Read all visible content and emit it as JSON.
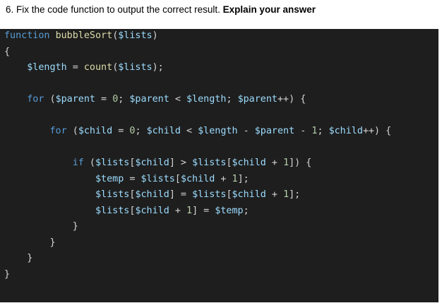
{
  "question": {
    "prefix": "6. Fix the code function to output the correct result. ",
    "bold": "Explain your answer"
  },
  "code": {
    "lines": [
      [
        {
          "t": "function",
          "c": "kw"
        },
        {
          "t": " ",
          "c": "op"
        },
        {
          "t": "bubbleSort",
          "c": "fn"
        },
        {
          "t": "(",
          "c": "op"
        },
        {
          "t": "$lists",
          "c": "var"
        },
        {
          "t": ")",
          "c": "op"
        }
      ],
      [
        {
          "t": "{",
          "c": "op"
        }
      ],
      [
        {
          "t": "    ",
          "c": "op"
        },
        {
          "t": "$length",
          "c": "var"
        },
        {
          "t": " = ",
          "c": "op"
        },
        {
          "t": "count",
          "c": "fn"
        },
        {
          "t": "(",
          "c": "op"
        },
        {
          "t": "$lists",
          "c": "var"
        },
        {
          "t": ");",
          "c": "op"
        }
      ],
      [],
      [
        {
          "t": "    ",
          "c": "op"
        },
        {
          "t": "for",
          "c": "kw"
        },
        {
          "t": " (",
          "c": "op"
        },
        {
          "t": "$parent",
          "c": "var"
        },
        {
          "t": " = ",
          "c": "op"
        },
        {
          "t": "0",
          "c": "num"
        },
        {
          "t": "; ",
          "c": "op"
        },
        {
          "t": "$parent",
          "c": "var"
        },
        {
          "t": " < ",
          "c": "op"
        },
        {
          "t": "$length",
          "c": "var"
        },
        {
          "t": "; ",
          "c": "op"
        },
        {
          "t": "$parent",
          "c": "var"
        },
        {
          "t": "++) {",
          "c": "op"
        }
      ],
      [],
      [
        {
          "t": "        ",
          "c": "op"
        },
        {
          "t": "for",
          "c": "kw"
        },
        {
          "t": " (",
          "c": "op"
        },
        {
          "t": "$child",
          "c": "var"
        },
        {
          "t": " = ",
          "c": "op"
        },
        {
          "t": "0",
          "c": "num"
        },
        {
          "t": "; ",
          "c": "op"
        },
        {
          "t": "$child",
          "c": "var"
        },
        {
          "t": " < ",
          "c": "op"
        },
        {
          "t": "$length",
          "c": "var"
        },
        {
          "t": " - ",
          "c": "op"
        },
        {
          "t": "$parent",
          "c": "var"
        },
        {
          "t": " - ",
          "c": "op"
        },
        {
          "t": "1",
          "c": "num"
        },
        {
          "t": "; ",
          "c": "op"
        },
        {
          "t": "$child",
          "c": "var"
        },
        {
          "t": "++) {",
          "c": "op"
        }
      ],
      [],
      [
        {
          "t": "            ",
          "c": "op"
        },
        {
          "t": "if",
          "c": "kw"
        },
        {
          "t": " (",
          "c": "op"
        },
        {
          "t": "$lists",
          "c": "var"
        },
        {
          "t": "[",
          "c": "op"
        },
        {
          "t": "$child",
          "c": "var"
        },
        {
          "t": "] > ",
          "c": "op"
        },
        {
          "t": "$lists",
          "c": "var"
        },
        {
          "t": "[",
          "c": "op"
        },
        {
          "t": "$child",
          "c": "var"
        },
        {
          "t": " + ",
          "c": "op"
        },
        {
          "t": "1",
          "c": "num"
        },
        {
          "t": "]) {",
          "c": "op"
        }
      ],
      [
        {
          "t": "                ",
          "c": "op"
        },
        {
          "t": "$temp",
          "c": "var"
        },
        {
          "t": " = ",
          "c": "op"
        },
        {
          "t": "$lists",
          "c": "var"
        },
        {
          "t": "[",
          "c": "op"
        },
        {
          "t": "$child",
          "c": "var"
        },
        {
          "t": " + ",
          "c": "op"
        },
        {
          "t": "1",
          "c": "num"
        },
        {
          "t": "];",
          "c": "op"
        }
      ],
      [
        {
          "t": "                ",
          "c": "op"
        },
        {
          "t": "$lists",
          "c": "var"
        },
        {
          "t": "[",
          "c": "op"
        },
        {
          "t": "$child",
          "c": "var"
        },
        {
          "t": "] = ",
          "c": "op"
        },
        {
          "t": "$lists",
          "c": "var"
        },
        {
          "t": "[",
          "c": "op"
        },
        {
          "t": "$child",
          "c": "var"
        },
        {
          "t": " + ",
          "c": "op"
        },
        {
          "t": "1",
          "c": "num"
        },
        {
          "t": "];",
          "c": "op"
        }
      ],
      [
        {
          "t": "                ",
          "c": "op"
        },
        {
          "t": "$lists",
          "c": "var"
        },
        {
          "t": "[",
          "c": "op"
        },
        {
          "t": "$child",
          "c": "var"
        },
        {
          "t": " + ",
          "c": "op"
        },
        {
          "t": "1",
          "c": "num"
        },
        {
          "t": "] = ",
          "c": "op"
        },
        {
          "t": "$temp",
          "c": "var"
        },
        {
          "t": ";",
          "c": "op"
        }
      ],
      [
        {
          "t": "            }",
          "c": "op"
        }
      ],
      [
        {
          "t": "        }",
          "c": "op"
        }
      ],
      [
        {
          "t": "    }",
          "c": "op"
        }
      ],
      [
        {
          "t": "}",
          "c": "op"
        }
      ]
    ]
  },
  "colors": {
    "background": "#1e1e1e",
    "keyword": "#569cd6",
    "function": "#dcdcaa",
    "variable": "#9cdcfe",
    "number": "#b5cea8",
    "operator": "#d4d4d4"
  }
}
